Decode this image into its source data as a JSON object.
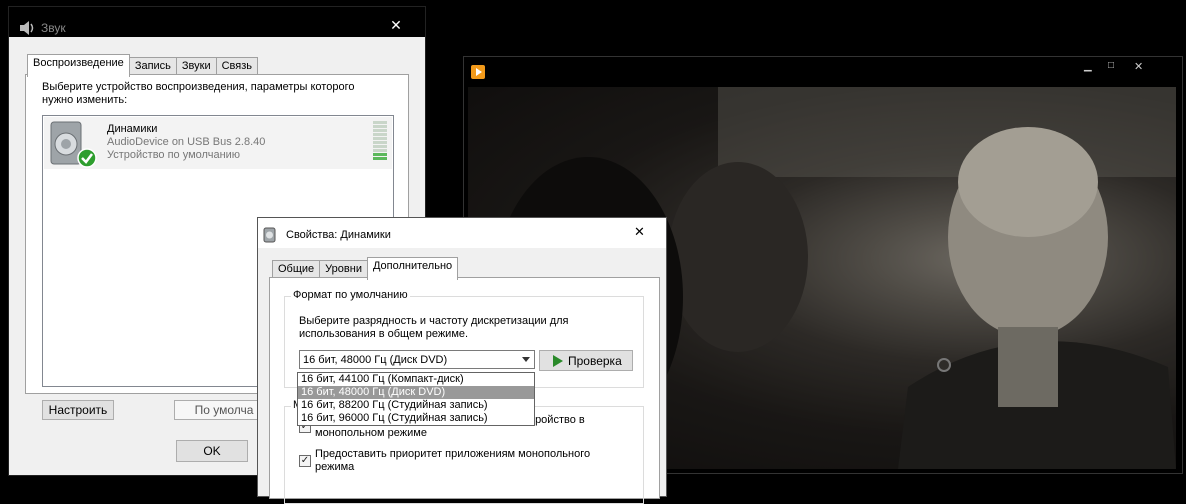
{
  "sound_window": {
    "title": "Звук",
    "close": "✕",
    "tabs": [
      "Воспроизведение",
      "Запись",
      "Звуки",
      "Связь"
    ],
    "instruction": "Выберите устройство воспроизведения, параметры которого нужно изменить:",
    "device": {
      "name": "Динамики",
      "description": "AudioDevice on USB Bus 2.8.40",
      "status": "Устройство по умолчанию"
    },
    "configure_button": "Настроить",
    "default_button": "По умолча",
    "ok_button": "OK"
  },
  "video_player": {
    "min": "▁",
    "max": "□",
    "close": "✕"
  },
  "props_dialog": {
    "title": "Свойства: Динамики",
    "close": "✕",
    "tabs": [
      "Общие",
      "Уровни",
      "Дополнительно"
    ],
    "group_title": "Формат по умолчанию",
    "group_desc": "Выберите разрядность и частоту дискретизации для использования в общем режиме.",
    "selected_format": "16 бит, 48000 Гц (Диск DVD)",
    "test_button": "Проверка",
    "dropdown_options": [
      "16 бит, 44100 Гц (Компакт-диск)",
      "16 бит, 48000 Гц (Диск DVD)",
      "16 бит, 88200 Гц (Студийная запись)",
      "16 бит, 96000 Гц (Студийная запись)"
    ],
    "group2_partial": "М",
    "exclusive_option_1": "Разрешить приложениям использовать устройство в монопольном режиме",
    "exclusive_option_2": "Предоставить приоритет приложениям монопольного режима",
    "checkmark": "✓"
  }
}
